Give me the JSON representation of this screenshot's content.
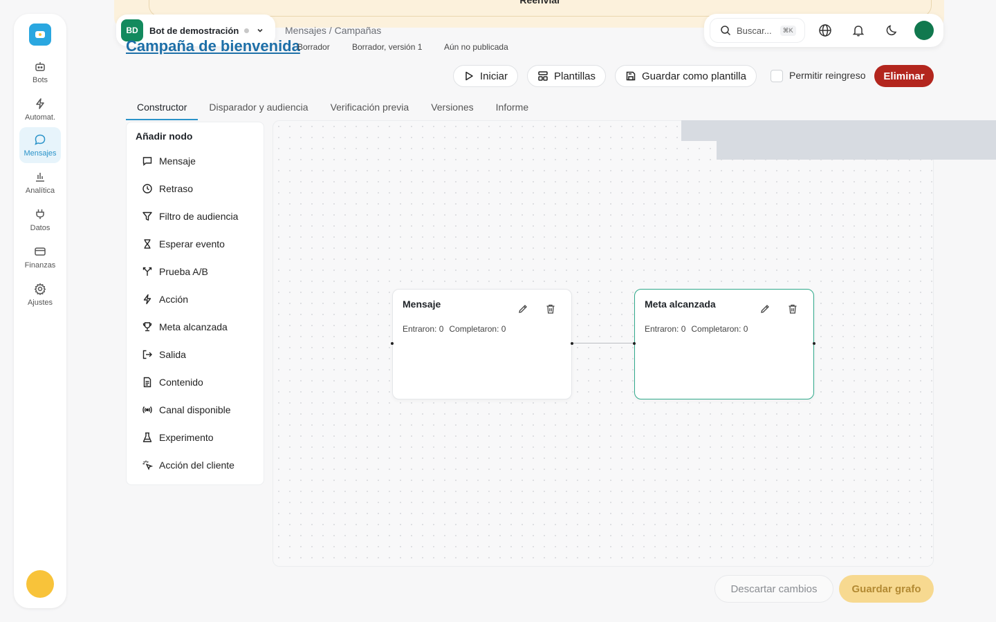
{
  "banner": {
    "text": "Reenviar"
  },
  "sidebar": {
    "items": [
      {
        "label": "Bots",
        "icon": "bot-icon"
      },
      {
        "label": "Automat.",
        "icon": "bolt-icon"
      },
      {
        "label": "Mensajes",
        "icon": "message-icon",
        "active": true
      },
      {
        "label": "Analítica",
        "icon": "chart-icon"
      },
      {
        "label": "Datos",
        "icon": "plug-icon"
      },
      {
        "label": "Finanzas",
        "icon": "card-icon"
      },
      {
        "label": "Ajustes",
        "icon": "gear-icon"
      }
    ]
  },
  "bot": {
    "initials": "BD",
    "name": "Bot de demostración"
  },
  "breadcrumb": "Mensajes / Campañas",
  "search": {
    "placeholder": "Buscar...",
    "shortcut": "⌘K"
  },
  "campaign": {
    "title": "Campaña de bienvenida",
    "status": "Borrador",
    "version": "Borrador, versión 1",
    "published": "Aún no publicada"
  },
  "actions": {
    "start": "Iniciar",
    "templates": "Plantillas",
    "save_template": "Guardar como plantilla",
    "allow_reentry": "Permitir reingreso",
    "delete": "Eliminar"
  },
  "tabs": [
    "Constructor",
    "Disparador y audiencia",
    "Verificación previa",
    "Versiones",
    "Informe"
  ],
  "palette": {
    "title": "Añadir nodo",
    "items": [
      {
        "label": "Mensaje",
        "icon": "chat-icon"
      },
      {
        "label": "Retraso",
        "icon": "clock-icon"
      },
      {
        "label": "Filtro de audiencia",
        "icon": "filter-icon"
      },
      {
        "label": "Esperar evento",
        "icon": "hourglass-icon"
      },
      {
        "label": "Prueba A/B",
        "icon": "split-icon"
      },
      {
        "label": "Acción",
        "icon": "bolt-icon"
      },
      {
        "label": "Meta alcanzada",
        "icon": "trophy-icon"
      },
      {
        "label": "Salida",
        "icon": "exit-icon"
      },
      {
        "label": "Contenido",
        "icon": "document-icon"
      },
      {
        "label": "Canal disponible",
        "icon": "broadcast-icon"
      },
      {
        "label": "Experimento",
        "icon": "flask-icon"
      },
      {
        "label": "Acción del cliente",
        "icon": "sparkle-icon"
      }
    ]
  },
  "nodes": [
    {
      "title": "Mensaje",
      "entered": "Entraron: 0",
      "completed": "Completaron: 0"
    },
    {
      "title": "Meta alcanzada",
      "entered": "Entraron: 0",
      "completed": "Completaron: 0"
    }
  ],
  "footer": {
    "discard": "Descartar cambios",
    "save": "Guardar grafo"
  },
  "colors": {
    "accent": "#2a93c9",
    "danger": "#b3261e",
    "bot_badge": "#138a5e",
    "goal_border": "#2ea88a",
    "save_button": "#f7d990"
  }
}
